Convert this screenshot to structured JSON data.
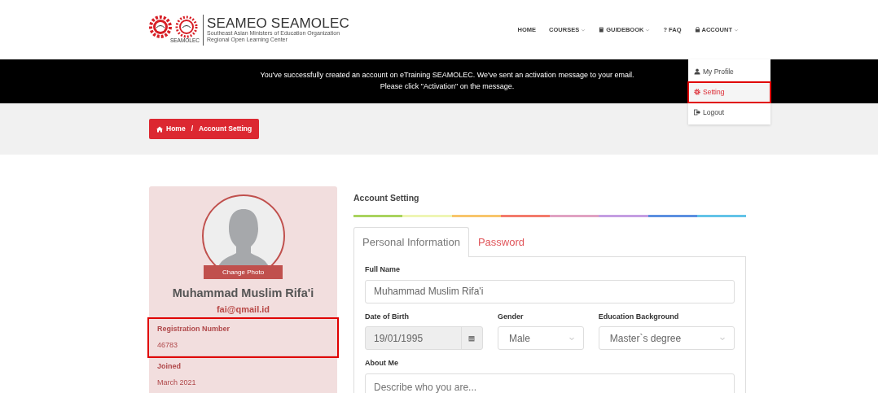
{
  "logo": {
    "title": "SEAMEO SEAMOLEC",
    "subtitle_lines": [
      "Southeast Asian Ministers of Education Organization",
      "Regional Open Learning Center"
    ],
    "emblem_caption": "SEAMOLEC"
  },
  "nav": [
    {
      "label": "HOME",
      "kind": "plain",
      "dropdown": false
    },
    {
      "label": "COURSES",
      "kind": "plain",
      "dropdown": true
    },
    {
      "label": "GUIDEBOOK",
      "kind": "book",
      "dropdown": true
    },
    {
      "label": "? FAQ",
      "kind": "plain",
      "dropdown": false
    },
    {
      "label": "ACCOUNT",
      "kind": "lock",
      "dropdown": true
    }
  ],
  "account_menu": {
    "open": true,
    "items": [
      {
        "label": "My Profile",
        "kind": "user",
        "selected": false,
        "highlighted": false
      },
      {
        "label": "Setting",
        "kind": "gear",
        "selected": true,
        "highlighted": true
      },
      {
        "label": "Logout",
        "kind": "logout",
        "selected": false,
        "highlighted": false
      }
    ]
  },
  "banner": {
    "lines": [
      "You've successfully created an account on eTraining SEAMOLEC. We've sent an activation message to your email.",
      "Please click \"Activation\" on the message."
    ]
  },
  "breadcrumb": {
    "separator": "/",
    "items": [
      {
        "label": "Home",
        "kind": "home"
      },
      {
        "label": "Account Setting",
        "kind": "plain"
      }
    ]
  },
  "profile": {
    "change_photo": "Change Photo",
    "name": "Muhammad Muslim Rifa'i",
    "email": "fai@qmail.id",
    "info": [
      {
        "label": "Registration Number",
        "value": "46783",
        "highlighted": true
      },
      {
        "label": "Joined",
        "value": "March 2021",
        "highlighted": false
      }
    ]
  },
  "settings": {
    "title": "Account Setting",
    "tabs": [
      {
        "label": "Personal Information",
        "selected": true
      },
      {
        "label": "Password",
        "selected": false
      }
    ],
    "rows": [
      [
        {
          "kind": "text",
          "label": "Full Name",
          "value": "Muhammad Muslim Rifa'i"
        }
      ],
      [
        {
          "kind": "date",
          "label": "Date of Birth",
          "value": "19/01/1995"
        },
        {
          "kind": "select",
          "label": "Gender",
          "value": "Male"
        },
        {
          "kind": "select",
          "label": "Education Background",
          "value": "Master`s degree"
        }
      ],
      [
        {
          "kind": "textarea",
          "label": "About Me",
          "placeholder": "Describe who you are..."
        }
      ]
    ]
  }
}
